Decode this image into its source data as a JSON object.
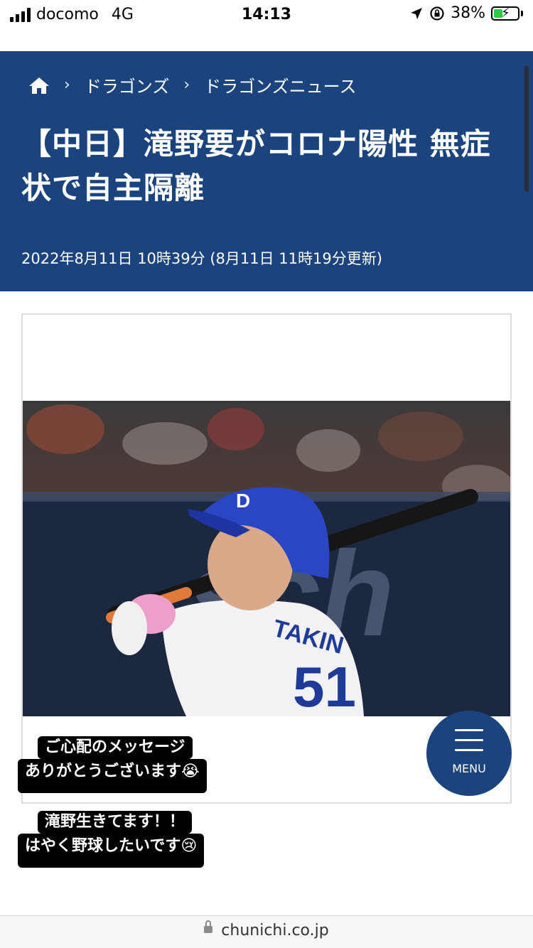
{
  "status_bar": {
    "carrier": "docomo",
    "network": "4G",
    "time": "14:13",
    "battery": "38%",
    "battery_level": 0.38
  },
  "breadcrumb": {
    "items": [
      "ドラゴンズ",
      "ドラゴンズニュース"
    ]
  },
  "article": {
    "title": "【中日】滝野要がコロナ陽性 無症状で自主隔離",
    "date": "2022年8月11日 10時39分 (8月11日 11時19分更新)",
    "photo_jersey_text": "TAKIN",
    "photo_number": "51",
    "photo_bg_text": "sch"
  },
  "stickers": {
    "first_line1": "ご心配のメッセージ",
    "first_line2": "ありがとうございます😭",
    "second_line1": "滝野生きてます！！",
    "second_line2": "はやく野球したいです😢"
  },
  "menu": {
    "label": "MENU"
  },
  "url_bar": {
    "domain": "chunichi.co.jp"
  },
  "colors": {
    "header_bg": "#1b447f",
    "menu_bg": "#1b447f"
  }
}
